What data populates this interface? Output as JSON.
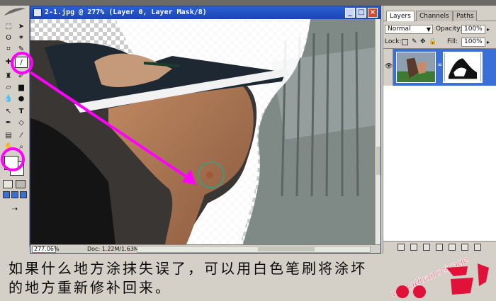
{
  "document": {
    "title": "2-1.jpg @ 277% (Layer 0, Layer Mask/8)",
    "zoom": "277.06%",
    "doc_size": "Doc: 1.22M/1.63M",
    "window_buttons": [
      "_",
      "□",
      "×"
    ]
  },
  "layers_panel": {
    "tabs": [
      {
        "label": "Layers",
        "active": true
      },
      {
        "label": "Channels",
        "active": false
      },
      {
        "label": "Paths",
        "active": false
      }
    ],
    "blend_mode": "Normal",
    "opacity_label": "Opacity:",
    "opacity_value": "100%",
    "lock_label": "Lock:",
    "fill_label": "Fill:",
    "fill_value": "100%"
  },
  "toolbox": {
    "tools": [
      "marquee-tool",
      "move-tool",
      "lasso-tool",
      "magic-wand-tool",
      "crop-tool",
      "slice-tool",
      "healing-tool",
      "brush-tool",
      "stamp-tool",
      "history-brush-tool",
      "eraser-tool",
      "gradient-tool",
      "blur-tool",
      "dodge-tool",
      "path-select-tool",
      "type-tool",
      "pen-tool",
      "shape-tool",
      "notes-tool",
      "eyedropper-tool",
      "hand-tool",
      "zoom-tool"
    ],
    "foreground_color": "#ffffff",
    "background_color": "#ffffff"
  },
  "annotation": {
    "highlight_color": "#ff00ff",
    "brush_cursor_color": "#22aa88"
  },
  "caption": {
    "line1": "如果什么地方涂抹失误了，可以用白色笔刷将涂坏",
    "line2": "的地方重新修补回来。",
    "watermark": "wangduanceiyage"
  }
}
